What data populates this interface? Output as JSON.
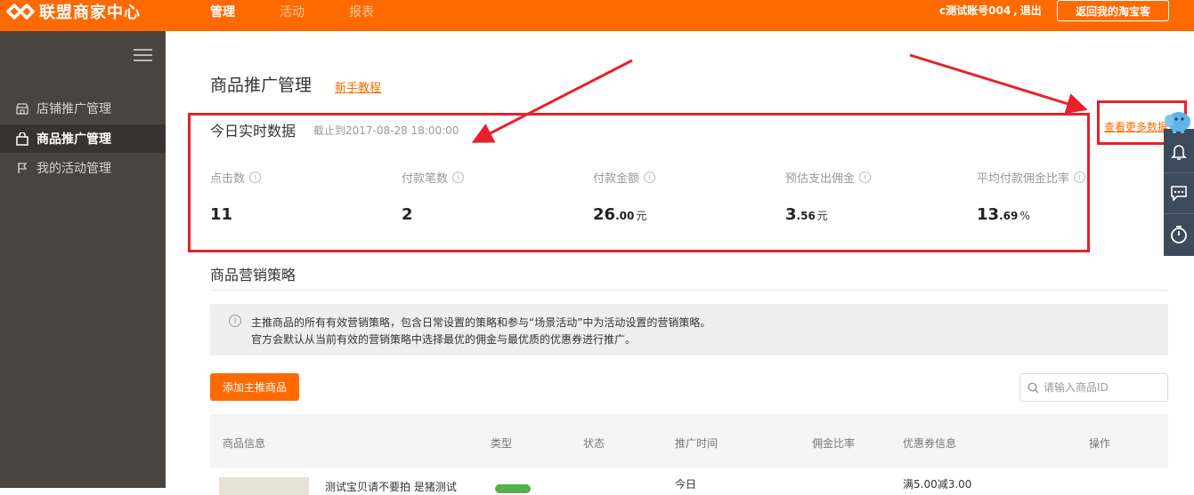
{
  "header": {
    "logo_text": "联盟商家中心",
    "nav": [
      {
        "label": "管理",
        "active": true
      },
      {
        "label": "活动",
        "active": false
      },
      {
        "label": "报表",
        "active": false
      }
    ],
    "account_name": "c测试账号004",
    "logout_label": "退出",
    "return_button": "返回我的淘宝客"
  },
  "sidebar": {
    "items": [
      {
        "label": "店铺推广管理",
        "icon": "store-icon",
        "active": false
      },
      {
        "label": "商品推广管理",
        "icon": "bag-icon",
        "active": true
      },
      {
        "label": "我的活动管理",
        "icon": "flag-icon",
        "active": false
      }
    ]
  },
  "main": {
    "title": "商品推广管理",
    "tutorial_link": "新手教程",
    "realtime": {
      "title": "今日实时数据",
      "as_of": "截止到2017-08-28 18:00:00",
      "more_link": "查看更多数据",
      "stats": [
        {
          "label": "点击数",
          "int": "11",
          "dec": "",
          "unit": ""
        },
        {
          "label": "付款笔数",
          "int": "2",
          "dec": "",
          "unit": ""
        },
        {
          "label": "付款金额",
          "int": "26",
          "dec": ".00",
          "unit": "元"
        },
        {
          "label": "预估支出佣金",
          "int": "3",
          "dec": ".56",
          "unit": "元"
        },
        {
          "label": "平均付款佣金比率",
          "int": "13",
          "dec": ".69",
          "unit": "%"
        }
      ]
    },
    "strategy": {
      "title": "商品营销策略",
      "notice_line1": "主推商品的所有有效营销策略，包含日常设置的策略和参与“场景活动”中为活动设置的营销策略。",
      "notice_line2": "官方会默认从当前有效的营销策略中选择最优的佣金与最优质的优惠券进行推广。",
      "add_button": "添加主推商品",
      "search_placeholder": "请输入商品ID"
    },
    "table": {
      "headers": [
        "商品信息",
        "类型",
        "状态",
        "推广时间",
        "佣金比率",
        "优惠券信息",
        "操作"
      ],
      "rows": [
        {
          "name": "测试宝贝请不要拍 是猪测试",
          "time": "今日",
          "coupon": "满5.00减3.00"
        }
      ]
    }
  },
  "colors": {
    "brand": "#ff6a00",
    "sidebar_bg": "#4a4340",
    "highlight_red": "#e8202a",
    "floatbar_bg": "#3d4a5c"
  }
}
